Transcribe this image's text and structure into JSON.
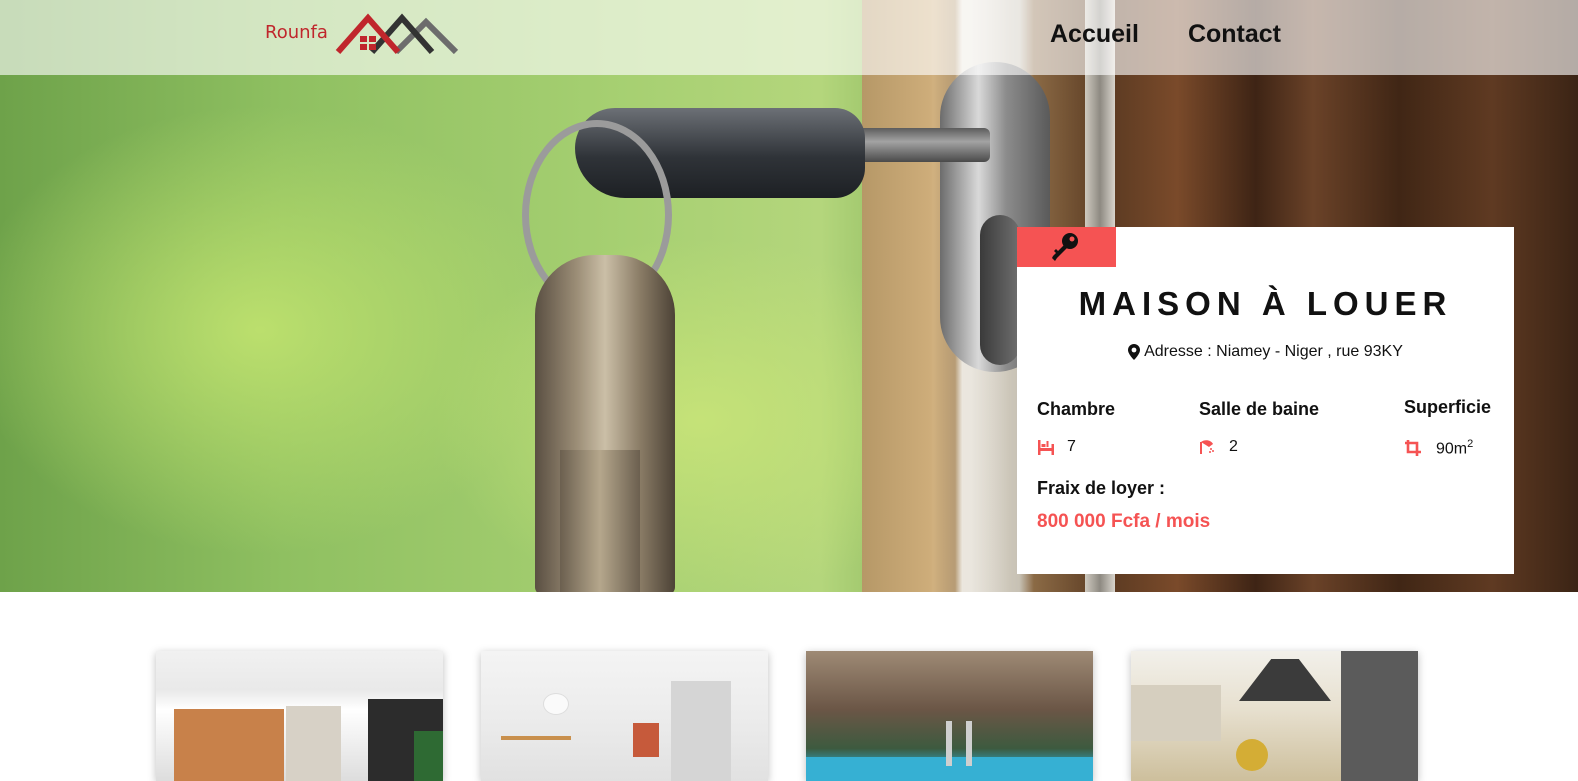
{
  "brand": {
    "name": "Rounfa",
    "logo_icon": "house-roofs-logo-icon",
    "accent_color": "#c0262c"
  },
  "nav": {
    "links": [
      {
        "label": "Accueil"
      },
      {
        "label": "Contact"
      }
    ]
  },
  "hero": {
    "image": "key-in-door-lock-photo"
  },
  "listing": {
    "badge_icon": "key-icon",
    "badge_color": "#f55353",
    "title": "MAISON À LOUER",
    "address_icon": "map-marker-icon",
    "address": "Adresse : Niamey - Niger , rue 93KY",
    "features": [
      {
        "label": "Chambre",
        "icon": "bed-icon",
        "value": "7"
      },
      {
        "label": "Salle de baine",
        "icon": "shower-icon",
        "value": "2"
      },
      {
        "label": "Superficie",
        "icon": "crop-icon",
        "value": "90m",
        "unit_sup": "2"
      }
    ],
    "rent_label": "Fraix de loyer :",
    "rent_value": "800 000 Fcfa / mois"
  },
  "gallery": [
    {
      "image": "kitchen-dining-room-photo"
    },
    {
      "image": "living-room-staircase-photo"
    },
    {
      "image": "swimming-pool-photo"
    },
    {
      "image": "modern-kitchen-photo"
    }
  ]
}
